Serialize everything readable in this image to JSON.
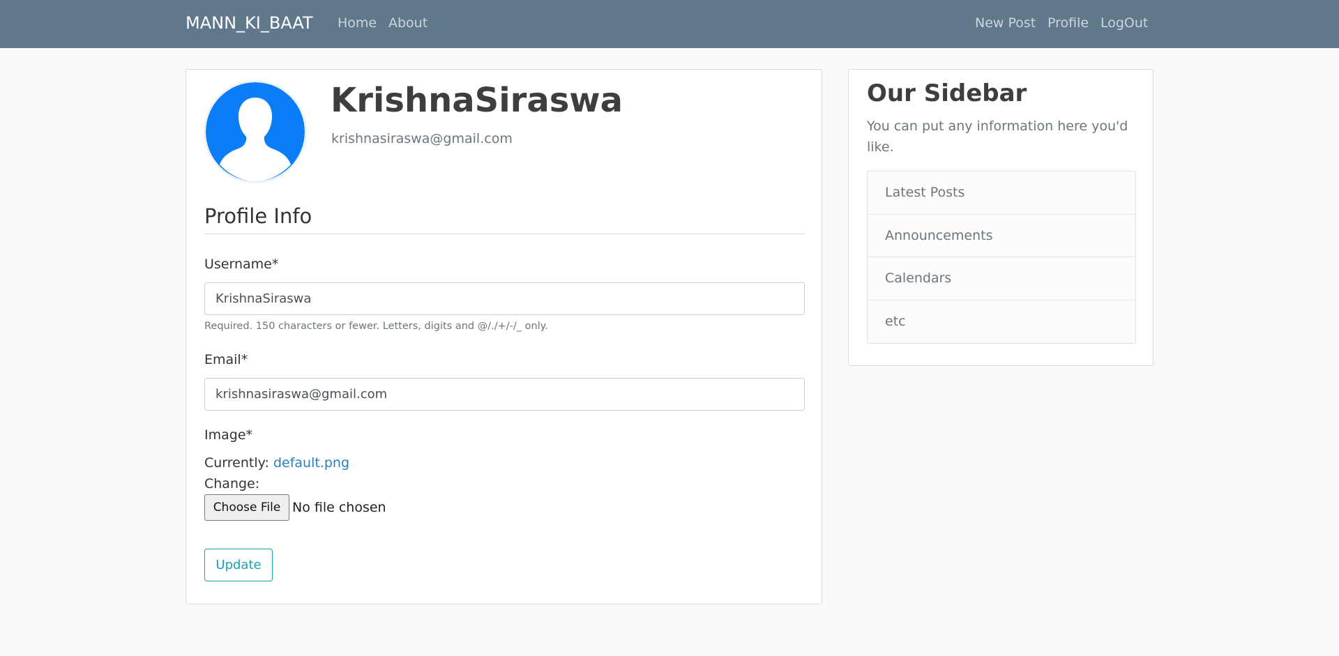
{
  "navbar": {
    "brand": "MANN_KI_BAAT",
    "left_links": [
      "Home",
      "About"
    ],
    "right_links": [
      "New Post",
      "Profile",
      "LogOut"
    ],
    "color": "#5f788a"
  },
  "profile": {
    "username": "KrishnaSiraswa",
    "email": "krishnasiraswa@gmail.com",
    "avatar_icon": "default-user-avatar-icon",
    "avatar_color": "#0a7df7"
  },
  "form": {
    "legend": "Profile Info",
    "username_label": "Username*",
    "username_value": "KrishnaSiraswa",
    "username_help": "Required. 150 characters or fewer. Letters, digits and @/./+/-/_ only.",
    "email_label": "Email*",
    "email_value": "krishnasiraswa@gmail.com",
    "image_label": "Image*",
    "currently_label": "Currently:",
    "current_file": "default.png",
    "change_label": "Change:",
    "choose_file_label": "Choose File",
    "file_status": "No file chosen",
    "submit_label": "Update"
  },
  "sidebar": {
    "title": "Our Sidebar",
    "text": "You can put any information here you'd like.",
    "items": [
      "Latest Posts",
      "Announcements",
      "Calendars",
      "etc"
    ]
  }
}
